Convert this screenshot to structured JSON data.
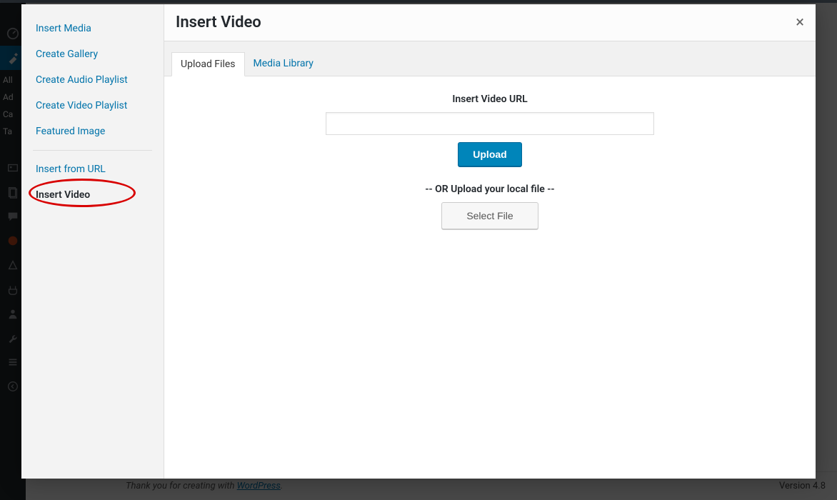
{
  "sidebar": {
    "items": [
      {
        "label": "Insert Media",
        "active": false
      },
      {
        "label": "Create Gallery",
        "active": false
      },
      {
        "label": "Create Audio Playlist",
        "active": false
      },
      {
        "label": "Create Video Playlist",
        "active": false
      },
      {
        "label": "Featured Image",
        "active": false
      }
    ],
    "items2": [
      {
        "label": "Insert from URL",
        "active": false
      },
      {
        "label": "Insert Video",
        "active": true
      }
    ]
  },
  "header": {
    "title": "Insert Video",
    "close_glyph": "×"
  },
  "tabs": [
    {
      "label": "Upload Files",
      "active": true
    },
    {
      "label": "Media Library",
      "active": false
    }
  ],
  "upload": {
    "url_label": "Insert Video URL",
    "url_value": "",
    "upload_btn": "Upload",
    "or_text": "-- OR Upload your local file --",
    "select_file_btn": "Select File"
  },
  "wp_submenu": [
    "All",
    "Ad",
    "Ca",
    "Ta"
  ],
  "footer": {
    "prefix": "Thank you for creating with ",
    "link": "WordPress",
    "suffix": ".",
    "version": "Version 4.8"
  }
}
